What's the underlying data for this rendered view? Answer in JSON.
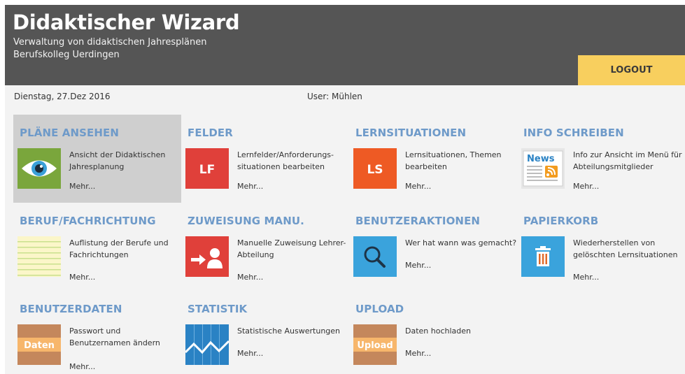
{
  "header": {
    "title": "Didaktischer Wizard",
    "subtitle": "Verwaltung von didaktischen Jahresplänen",
    "school": "Berufskolleg Uerdingen",
    "logout_label": "LOGOUT"
  },
  "info": {
    "date": "Dienstag, 27.Dez 2016",
    "user": "User: Mühlen"
  },
  "tiles": [
    {
      "title": "PLÄNE ANSEHEN",
      "desc": "Ansicht der Didaktischen Jahresplanung",
      "more": "Mehr...",
      "icon": "eye-icon",
      "color": "#7aa63c"
    },
    {
      "title": "FELDER",
      "desc": "Lernfelder/Anforderungs-situationen bearbeiten",
      "more": "Mehr...",
      "icon": "lf-icon",
      "icon_text": "LF",
      "color": "#e0403a"
    },
    {
      "title": "LERNSITUATIONEN",
      "desc": "Lernsituationen, Themen bearbeiten",
      "more": "Mehr...",
      "icon": "ls-icon",
      "icon_text": "LS",
      "color": "#ee5a24"
    },
    {
      "title": "INFO SCHREIBEN",
      "desc": "Info zur Ansicht im Menü für Abteilungsmitglieder",
      "more": "Mehr...",
      "icon": "news-icon",
      "icon_text": "News",
      "color": "#e8e8e8"
    },
    {
      "title": "BERUF/FACHRICHTUNG",
      "desc": "Auflistung der Berufe und Fachrichtungen",
      "more": "Mehr...",
      "icon": "list-paper-icon",
      "color": "#fbf6c9"
    },
    {
      "title": "ZUWEISUNG MANU.",
      "desc": "Manuelle Zuweisung Lehrer-Abteilung",
      "more": "Mehr...",
      "icon": "assign-user-icon",
      "color": "#e0403a"
    },
    {
      "title": "BENUTZERAKTIONEN",
      "desc": "Wer hat wann was gemacht?",
      "more": "Mehr...",
      "icon": "search-icon",
      "color": "#3aa3dc"
    },
    {
      "title": "PAPIERKORB",
      "desc": "Wiederherstellen von gelöschten Lernsituationen",
      "more": "Mehr...",
      "icon": "trash-icon",
      "color": "#3aa3dc"
    },
    {
      "title": "BENUTZERDATEN",
      "desc": "Passwort und Benutzernamen ändern",
      "more": "Mehr...",
      "icon": "daten-icon",
      "icon_text": "Daten",
      "color": "#c4875c"
    },
    {
      "title": "STATISTIK",
      "desc": "Statistische Auswertungen",
      "more": "Mehr...",
      "icon": "chart-icon",
      "color": "#2a82c4"
    },
    {
      "title": "UPLOAD",
      "desc": "Daten hochladen",
      "more": "Mehr...",
      "icon": "upload-icon",
      "icon_text": "Upload",
      "color": "#c4875c"
    }
  ]
}
